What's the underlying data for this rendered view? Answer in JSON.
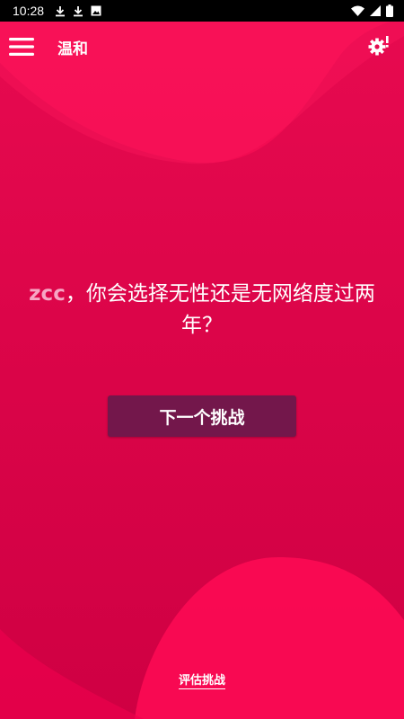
{
  "status_bar": {
    "time": "10:28",
    "icons_left": [
      "download-icon",
      "download-icon",
      "image-icon"
    ],
    "icons_right": [
      "wifi-icon",
      "signal-icon",
      "battery-icon"
    ]
  },
  "header": {
    "title": "温和",
    "menu_icon": "hamburger-menu-icon",
    "settings_icon": "settings-gear-alert-icon"
  },
  "main": {
    "player_name": "zcc",
    "question_text": "，你会选择无性还是无网络度过两年？",
    "next_button_label": "下一个挑战"
  },
  "footer": {
    "rate_link_label": "评估挑战"
  },
  "colors": {
    "background": "#dc0549",
    "wave_light": "#ff0a55",
    "button": "#73174b",
    "name_highlight": "#f7a6c4"
  }
}
